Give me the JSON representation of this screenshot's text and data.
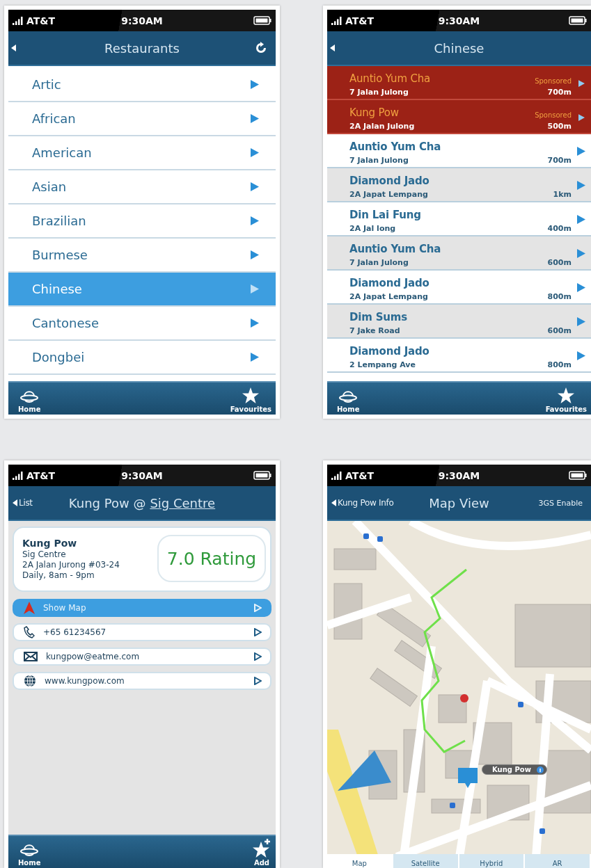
{
  "screens": [
    {
      "kind": "categories",
      "status_bar": {
        "carrier": "AT&T",
        "time": "9:30AM"
      },
      "nav": {
        "title": "Restaurants",
        "refresh": true
      },
      "items": [
        {
          "label": "Artic",
          "selected": false
        },
        {
          "label": "African",
          "selected": false
        },
        {
          "label": "American",
          "selected": false
        },
        {
          "label": "Asian",
          "selected": false
        },
        {
          "label": "Brazilian",
          "selected": false
        },
        {
          "label": "Burmese",
          "selected": false
        },
        {
          "label": "Chinese",
          "selected": true
        },
        {
          "label": "Cantonese",
          "selected": false
        },
        {
          "label": "Dongbei",
          "selected": false
        }
      ],
      "tab_bar": [
        {
          "kind": "home",
          "label": "Home"
        },
        {
          "kind": "favourites",
          "label": "Favourites"
        }
      ]
    },
    {
      "kind": "restaurants",
      "status_bar": {
        "carrier": "AT&T",
        "time": "9:30AM"
      },
      "nav": {
        "title": "Chinese"
      },
      "items": [
        {
          "name": "Auntio Yum Cha",
          "address": "7 Jalan Julong",
          "distance": "700m",
          "sponsored": true,
          "badge": "Sponsored"
        },
        {
          "name": "Kung Pow",
          "address": "2A Jalan Julong",
          "distance": "500m",
          "sponsored": true,
          "badge": "Sponsored"
        },
        {
          "name": "Auntio Yum Cha",
          "address": "7 Jalan Julong",
          "distance": "700m",
          "sponsored": false
        },
        {
          "name": "Diamond Jado",
          "address": "2A Japat Lempang",
          "distance": "1km",
          "sponsored": false
        },
        {
          "name": "Din Lai Fung",
          "address": "2A Jal long",
          "distance": "400m",
          "sponsored": false
        },
        {
          "name": "Auntio Yum Cha",
          "address": "7 Jalan Julong",
          "distance": "600m",
          "sponsored": false
        },
        {
          "name": "Diamond Jado",
          "address": "2A Japat Lempang",
          "distance": "800m",
          "sponsored": false
        },
        {
          "name": "Dim Sums",
          "address": "7 Jake Road",
          "distance": "600m",
          "sponsored": false
        },
        {
          "name": "Diamond Jado",
          "address": "2 Lempang Ave",
          "distance": "800m",
          "sponsored": false
        }
      ],
      "tab_bar": [
        {
          "kind": "home",
          "label": "Home"
        },
        {
          "kind": "favourites",
          "label": "Favourites"
        }
      ]
    },
    {
      "kind": "detail",
      "status_bar": {
        "carrier": "AT&T",
        "time": "9:30AM"
      },
      "nav": {
        "back": "List",
        "title": "Kung Pow @",
        "title_link": "Sig Centre"
      },
      "card": {
        "name": "Kung Pow",
        "venue": "Sig Centre",
        "address": "2A Jalan Jurong #03-24",
        "hours": "Daily, 8am - 9pm",
        "rating": "7.0 Rating"
      },
      "actions": [
        {
          "kind": "map",
          "label": "Show Map",
          "selected": true
        },
        {
          "kind": "phone",
          "label": "+65 61234567",
          "selected": false
        },
        {
          "kind": "email",
          "label": "kungpow@eatme.com",
          "selected": false
        },
        {
          "kind": "web",
          "label": "www.kungpow.com",
          "selected": false
        }
      ],
      "tab_bar": [
        {
          "kind": "home",
          "label": "Home"
        },
        {
          "kind": "add",
          "label": "Add"
        }
      ]
    },
    {
      "kind": "map",
      "status_bar": {
        "carrier": "AT&T",
        "time": "9:30AM"
      },
      "nav": {
        "back": "Kung Pow Info",
        "title": "Map View",
        "right": "3GS Enable"
      },
      "pin_label": "Kung Pow",
      "map_modes": [
        {
          "label": "Map",
          "selected": true
        },
        {
          "label": "Satellite",
          "selected": false
        },
        {
          "label": "Hybrid",
          "selected": false
        },
        {
          "label": "AR",
          "selected": false
        }
      ]
    }
  ]
}
